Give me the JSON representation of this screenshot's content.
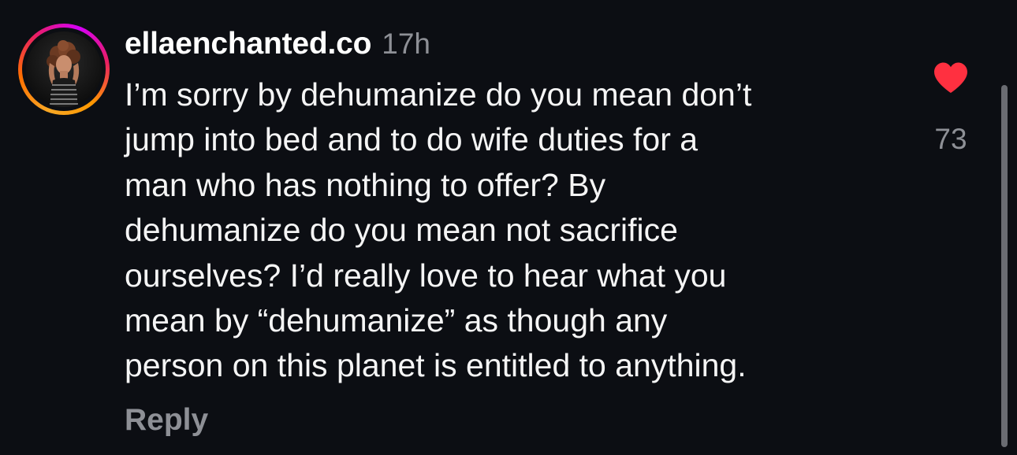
{
  "comment": {
    "username": "ellaenchanted.co",
    "timestamp": "17h",
    "text_lines": [
      "I’m sorry by dehumanize do you mean don’t",
      "jump into bed and to do wife duties for a",
      "man who has nothing to offer? By",
      "dehumanize do you mean not sacrifice",
      "ourselves? I’d really love to hear what you",
      "mean by “dehumanize” as though any",
      "person on this planet is entitled to anything."
    ],
    "reply_label": "Reply",
    "like_count": "73",
    "liked": true,
    "heart_color": "#ff3040"
  },
  "icons": {
    "heart": "heart-filled-icon",
    "avatar": "profile-photo"
  }
}
